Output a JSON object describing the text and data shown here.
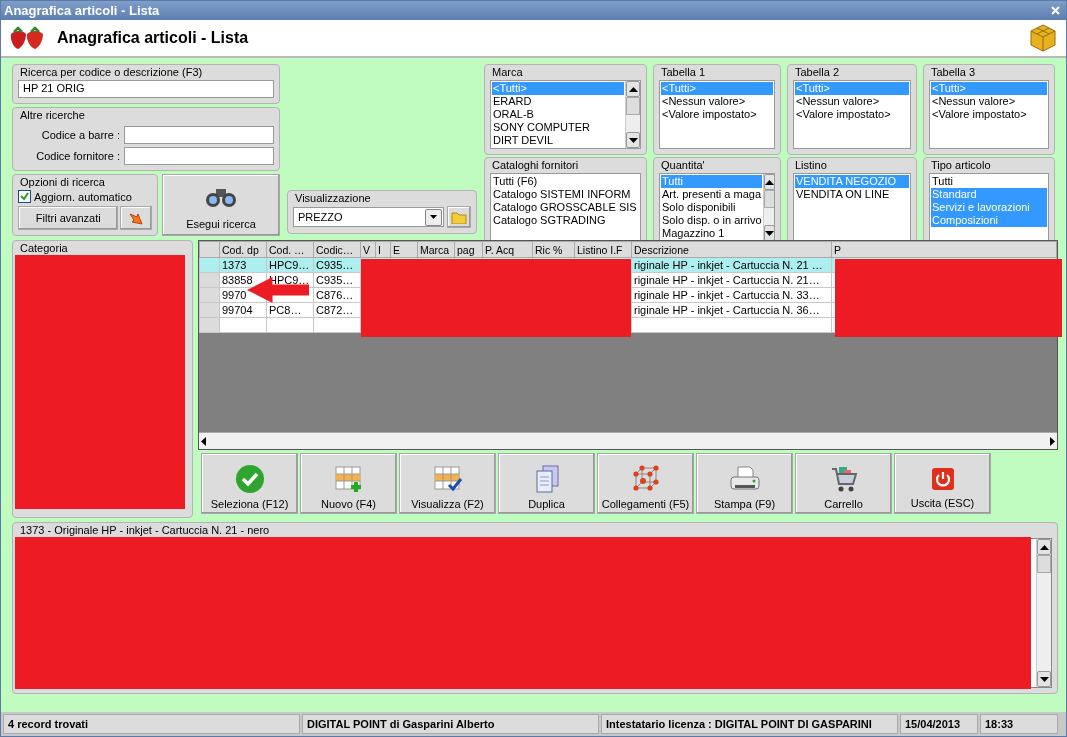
{
  "window": {
    "title": "Anagrafica articoli  - Lista"
  },
  "header": {
    "title": "Anagrafica articoli  - Lista"
  },
  "search": {
    "label": "Ricerca per codice o descrizione (F3)",
    "value": "HP 21 ORIG"
  },
  "other_searches": {
    "label": "Altre ricerche",
    "fields": [
      {
        "label": "Codice a barre :"
      },
      {
        "label": "Codice fornitore :"
      }
    ]
  },
  "options": {
    "label": "Opzioni di ricerca",
    "auto_update": {
      "label": "Aggiorn. automatico",
      "checked": true
    },
    "advanced_button": "Filtri avanzati"
  },
  "search_button": "Esegui ricerca",
  "view": {
    "label": "Visualizzazione",
    "value": "PREZZO"
  },
  "filters": [
    {
      "label": "Marca",
      "scrollbar": true,
      "items": [
        {
          "text": "<Tutti>",
          "selected": true
        },
        {
          "text": "ERARD",
          "selected": false
        },
        {
          "text": "ORAL-B",
          "selected": false
        },
        {
          "text": "SONY COMPUTER",
          "selected": false
        },
        {
          "text": "DIRT DEVIL",
          "selected": false
        }
      ]
    },
    {
      "label": "Tabella 1",
      "scrollbar": false,
      "items": [
        {
          "text": "<Tutti>",
          "selected": true
        },
        {
          "text": "<Nessun valore>",
          "selected": false
        },
        {
          "text": "<Valore impostato>",
          "selected": false
        }
      ]
    },
    {
      "label": "Tabella 2",
      "scrollbar": false,
      "items": [
        {
          "text": "<Tutti>",
          "selected": true
        },
        {
          "text": "<Nessun valore>",
          "selected": false
        },
        {
          "text": "<Valore impostato>",
          "selected": false
        }
      ]
    },
    {
      "label": "Tabella 3",
      "scrollbar": false,
      "items": [
        {
          "text": "<Tutti>",
          "selected": true
        },
        {
          "text": "<Nessun valore>",
          "selected": false
        },
        {
          "text": "<Valore impostato>",
          "selected": false
        }
      ]
    },
    {
      "label": "Cataloghi fornitori",
      "scrollbar": false,
      "items": [
        {
          "text": "Tutti (F6)",
          "selected": false
        },
        {
          "text": "Catalogo SISTEMI INFORM",
          "selected": false
        },
        {
          "text": "Catalogo GROSSCABLE SIS",
          "selected": false
        },
        {
          "text": "Catalogo SGTRADING",
          "selected": false
        }
      ]
    },
    {
      "label": "Quantita'",
      "scrollbar": true,
      "items": [
        {
          "text": "Tutti",
          "selected": true
        },
        {
          "text": "Art. presenti a maga",
          "selected": false
        },
        {
          "text": "Solo disponibili",
          "selected": false
        },
        {
          "text": "Solo disp. o in arrivo",
          "selected": false
        },
        {
          "text": "Magazzino 1",
          "selected": false
        }
      ]
    },
    {
      "label": "Listino",
      "scrollbar": false,
      "items": [
        {
          "text": "VENDITA NEGOZIO",
          "selected": true
        },
        {
          "text": "VENDITA ON LINE",
          "selected": false
        }
      ]
    },
    {
      "label": "Tipo articolo",
      "scrollbar": false,
      "items": [
        {
          "text": "Tutti",
          "selected": false
        },
        {
          "text": "Standard",
          "selected": true
        },
        {
          "text": "Servizi e lavorazioni",
          "selected": true
        },
        {
          "text": "Composizioni",
          "selected": true
        }
      ]
    }
  ],
  "category": {
    "label": "Categoria"
  },
  "table": {
    "columns": [
      "Cod. dp",
      "Cod. …",
      "Codic…",
      "V",
      "I",
      "E",
      "Marca",
      "pag",
      "P. Acq",
      "Ric %",
      "Listino I.F",
      "Descrizione",
      "P"
    ],
    "rows": [
      {
        "selected": true,
        "cells": [
          "1373",
          "HPC9…",
          "C935…",
          "riginale HP - inkjet - Cartuccia N. 21 …"
        ]
      },
      {
        "selected": false,
        "cells": [
          "83858",
          "HPC9…",
          "C935…",
          "riginale HP - inkjet - Cartuccia N. 21…"
        ]
      },
      {
        "selected": false,
        "cells": [
          "9970",
          null,
          "C876…",
          "riginale HP - inkjet - Cartuccia N. 33…"
        ]
      },
      {
        "selected": false,
        "cells": [
          "99704",
          "PC8…",
          "C872…",
          "riginale HP - inkjet - Cartuccia N. 36…"
        ]
      }
    ]
  },
  "buttons": [
    {
      "label": "Seleziona (F12)"
    },
    {
      "label": "Nuovo (F4)"
    },
    {
      "label": "Visualizza (F2)"
    },
    {
      "label": "Duplica"
    },
    {
      "label": "Collegamenti (F5)"
    },
    {
      "label": "Stampa (F9)"
    },
    {
      "label": "Carrello"
    },
    {
      "label": "Uscita (ESC)"
    }
  ],
  "detail": {
    "label": "1373 - Originale HP - inkjet - Cartuccia N. 21 - nero"
  },
  "status_bar": [
    "4 record trovati",
    "DIGITAL POINT di Gasparini Alberto",
    "Intestatario licenza : DIGITAL POINT DI GASPARINI",
    "15/04/2013",
    "18:33"
  ]
}
